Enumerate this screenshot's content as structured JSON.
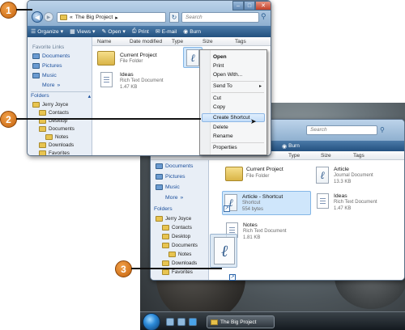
{
  "callouts": [
    "1",
    "2",
    "3"
  ],
  "window1": {
    "breadcrumb": "The Big Project",
    "search_placeholder": "Search",
    "toolbar": [
      "Organize",
      "Views",
      "Open",
      "Print",
      "E-mail",
      "Burn"
    ],
    "columns": [
      "Name",
      "Date modified",
      "Type",
      "Size",
      "Tags"
    ],
    "favorites_heading": "Favorite Links",
    "favorites": [
      "Documents",
      "Pictures",
      "Music"
    ],
    "more": "More",
    "folders_heading": "Folders",
    "tree": [
      "Jerry Joyce",
      "Contacts",
      "Desktop",
      "Documents",
      "Notes",
      "Downloads",
      "Favorites"
    ],
    "files": [
      {
        "name": "Current Project",
        "type": "File Folder"
      },
      {
        "name": "Ideas",
        "type": "Rich Text Document",
        "size": "1.47 KB"
      }
    ]
  },
  "context_menu": {
    "items": [
      "Open",
      "Print",
      "Open With...",
      "Send To",
      "Cut",
      "Copy",
      "Create Shortcut",
      "Delete",
      "Rename",
      "Properties"
    ],
    "highlighted": "Create Shortcut"
  },
  "window2": {
    "search_placeholder": "Search",
    "toolbar_burn": "Burn",
    "columns": [
      "Type",
      "Size",
      "Tags"
    ],
    "favorites": [
      "Documents",
      "Pictures",
      "Music"
    ],
    "more": "More",
    "folders_heading": "Folders",
    "tree": [
      "Jerry Joyce",
      "Contacts",
      "Desktop",
      "Documents",
      "Notes",
      "Downloads",
      "Favorites"
    ],
    "files": [
      {
        "name": "Current Project",
        "type": "File Folder"
      },
      {
        "name": "Article",
        "type": "Journal Document",
        "size": "13.3 KB"
      },
      {
        "name": "Article - Shortcut",
        "type": "Shortcut",
        "size": "554 bytes"
      },
      {
        "name": "Ideas",
        "type": "Rich Text Document",
        "size": "1.47 KB"
      },
      {
        "name": "Notes",
        "type": "Rich Text Document",
        "size": "1.81 KB"
      }
    ]
  },
  "taskbar": {
    "window_button": "The Big Project"
  },
  "colors": {
    "accent": "#2c5f92",
    "callout": "#e07a1c",
    "highlight": "#c4def9"
  }
}
